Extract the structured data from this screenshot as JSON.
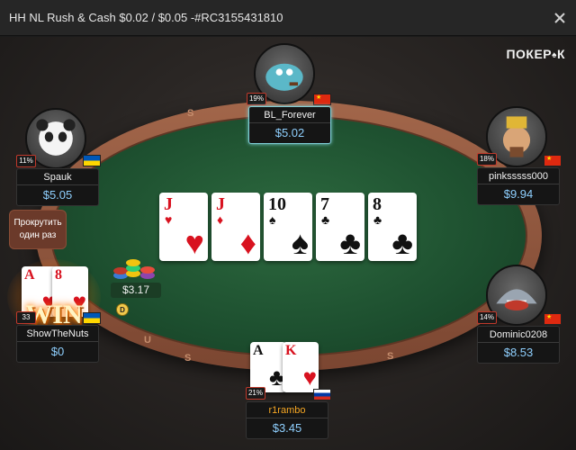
{
  "window": {
    "title": "HH NL Rush & Cash $0.02 / $0.05 -#RC3155431810"
  },
  "brand": {
    "name": "ПОКЕР",
    "suffix": "К"
  },
  "table": {
    "rail_letters": [
      "S",
      "U",
      "S",
      "S"
    ],
    "board": [
      {
        "rank": "J",
        "suit": "♥",
        "color": "red"
      },
      {
        "rank": "J",
        "suit": "♦",
        "color": "red"
      },
      {
        "rank": "10",
        "suit": "♠",
        "color": "black"
      },
      {
        "rank": "7",
        "suit": "♣",
        "color": "black"
      },
      {
        "rank": "8",
        "suit": "♣",
        "color": "black"
      }
    ],
    "pot": "$3.17",
    "dealer_button": "D",
    "win_label": "WIN",
    "run_it_button": "Прокрутить один раз"
  },
  "players": {
    "top": {
      "name": "BL_Forever",
      "stack": "$5.02",
      "pct": "19%",
      "flag": "cn"
    },
    "left": {
      "name": "Spauk",
      "stack": "$5.05",
      "pct": "11%",
      "flag": "ua"
    },
    "right": {
      "name": "pinksssss000",
      "stack": "$9.94",
      "pct": "18%",
      "flag": "cn"
    },
    "winner": {
      "name": "ShowTheNuts",
      "stack": "$0",
      "pct": "33",
      "flag": "ua",
      "cards": [
        {
          "rank": "A",
          "suit": "♥",
          "color": "red"
        },
        {
          "rank": "8",
          "suit": "♥",
          "color": "red"
        }
      ]
    },
    "right_low": {
      "name": "Dominic0208",
      "stack": "$8.53",
      "pct": "14%",
      "flag": "cn"
    },
    "hero": {
      "name": "r1rambo",
      "stack": "$3.45",
      "pct": "21%",
      "flag": "ru",
      "cards": [
        {
          "rank": "A",
          "suit": "♣",
          "color": "black"
        },
        {
          "rank": "K",
          "suit": "♥",
          "color": "red"
        }
      ]
    }
  },
  "colors": {
    "felt": "#1d4f2f",
    "rail": "#8b5238",
    "stack_text": "#8fd0ff",
    "hero_name": "#f5a623"
  }
}
